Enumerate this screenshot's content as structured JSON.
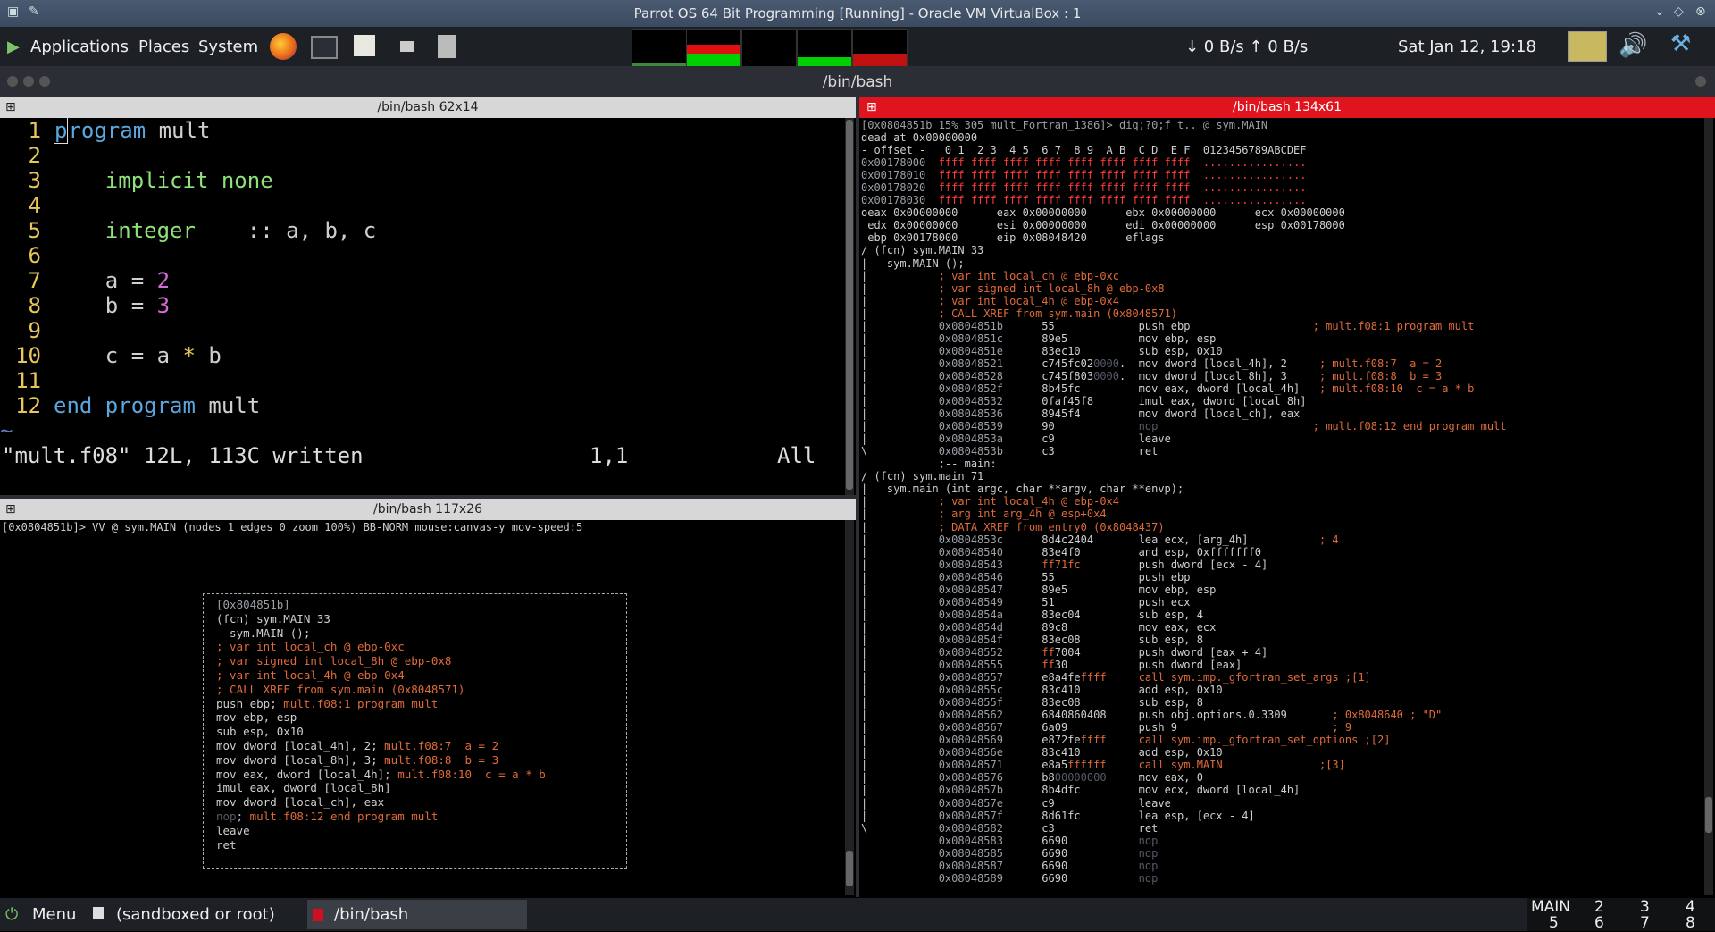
{
  "vbox": {
    "title": "Parrot OS 64 Bit Programming [Running] - Oracle VM VirtualBox : 1"
  },
  "panel": {
    "menus": [
      "Applications",
      "Places",
      "System"
    ],
    "net": "↓ 0 B/s ↑ 0 B/s",
    "clock": "Sat Jan 12, 19:18"
  },
  "window": {
    "title": "/bin/bash"
  },
  "panes": {
    "vim_title": "/bin/bash 62x14",
    "graph_title": "/bin/bash 117x26",
    "r2_title": "/bin/bash 134x61"
  },
  "vim": {
    "line_numbers": [
      "1",
      "2",
      "3",
      "4",
      "5",
      "6",
      "7",
      "8",
      "9",
      "10",
      "11",
      "12"
    ],
    "tilde": "~",
    "status_file": "\"mult.f08\" 12L, 113C written",
    "status_pos": "1,1",
    "status_all": "All"
  },
  "graph": {
    "header": "[0x0804851b]> VV @ sym.MAIN (nodes 1 edges 0 zoom 100%) BB-NORM mouse:canvas-y mov-speed:5"
  },
  "r2": {
    "prompt": "[0x0804851b 15% 305 mult_Fortran_1386]> diq;?0;f t.. @ sym.MAIN",
    "dead": "dead at 0x00000000"
  },
  "bottom": {
    "menu": "Menu",
    "task1": "(sandboxed or root)",
    "task2": "/bin/bash",
    "workspaces": [
      "MAIN",
      "2",
      "3",
      "4",
      "5",
      "6",
      "7",
      "8"
    ]
  },
  "colors": {
    "active_pane": "#e0141e",
    "panel_bg": "#1d2126"
  }
}
